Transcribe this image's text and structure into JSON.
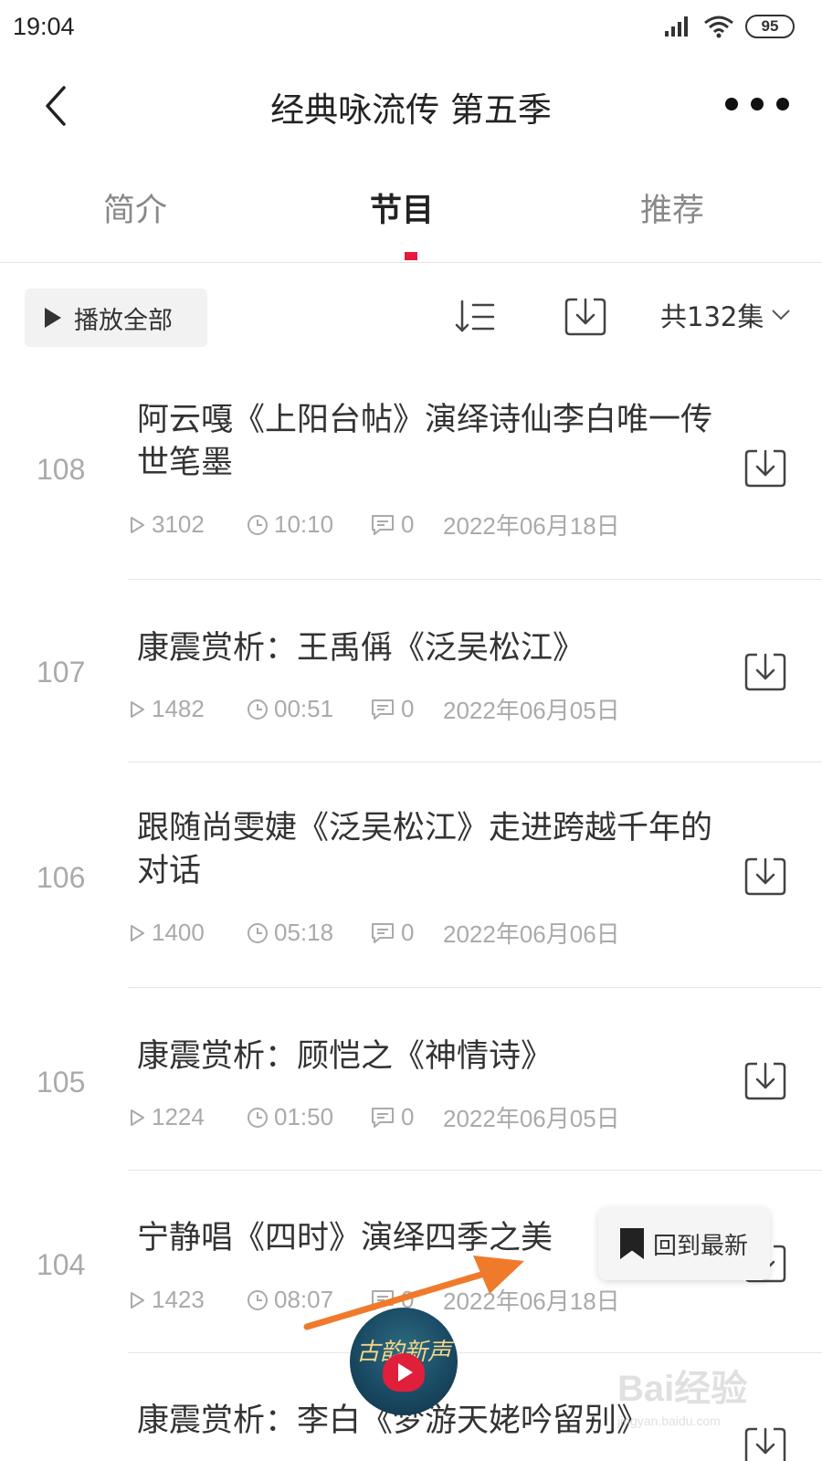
{
  "status_bar": {
    "time": "19:04",
    "battery": "95"
  },
  "header": {
    "title": "经典咏流传 第五季"
  },
  "tabs": [
    {
      "label": "简介"
    },
    {
      "label": "节目"
    },
    {
      "label": "推荐"
    }
  ],
  "toolbar": {
    "play_all_label": "播放全部",
    "episode_count_label": "共132集"
  },
  "episodes": [
    {
      "number": "108",
      "title": "阿云嘎《上阳台帖》演绎诗仙李白唯一传世笔墨",
      "views": "3102",
      "duration": "10:10",
      "comments": "0",
      "date": "2022年06月18日"
    },
    {
      "number": "107",
      "title": "康震赏析：王禹偁《泛吴松江》",
      "views": "1482",
      "duration": "00:51",
      "comments": "0",
      "date": "2022年06月05日"
    },
    {
      "number": "106",
      "title": "跟随尚雯婕《泛吴松江》走进跨越千年的对话",
      "views": "1400",
      "duration": "05:18",
      "comments": "0",
      "date": "2022年06月06日"
    },
    {
      "number": "105",
      "title": "康震赏析：顾恺之《神情诗》",
      "views": "1224",
      "duration": "01:50",
      "comments": "0",
      "date": "2022年06月05日"
    },
    {
      "number": "104",
      "title": "宁静唱《四时》演绎四季之美",
      "views": "1423",
      "duration": "08:07",
      "comments": "0",
      "date": "2022年06月18日"
    },
    {
      "number": "",
      "title": "康震赏析：李白《梦游天姥吟留别》",
      "views": "",
      "duration": "",
      "comments": "",
      "date": ""
    }
  ],
  "floating": {
    "back_to_latest_label": "回到最新",
    "player_disc_text": "古韵新声"
  },
  "watermark": {
    "brand": "Bai经验",
    "url": "jingyan.baidu.com"
  },
  "colors": {
    "accent": "#e8173d",
    "arrow": "#f07a2c"
  }
}
